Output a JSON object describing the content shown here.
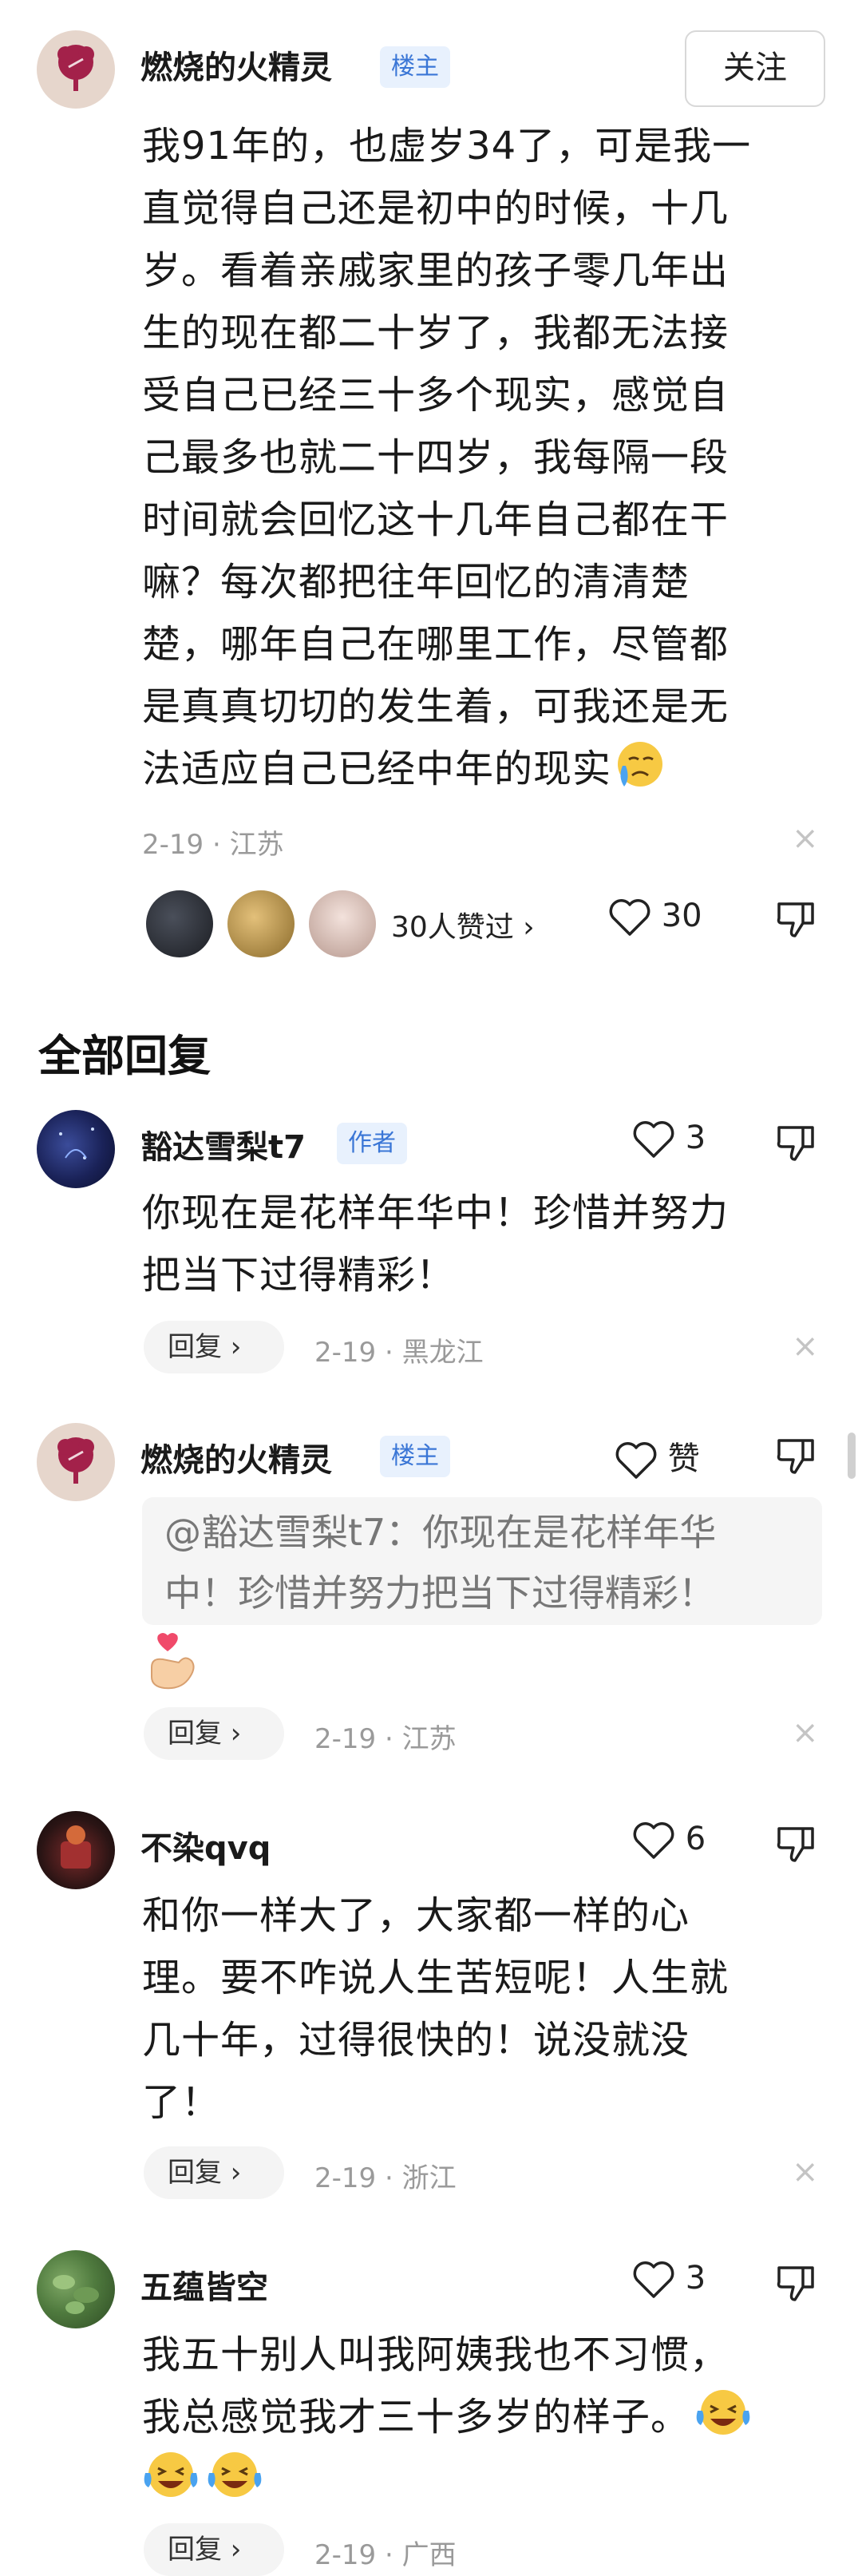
{
  "main_comment": {
    "author": "燃烧的火精灵",
    "badge": "楼主",
    "follow_label": "关注",
    "lines": [
      "我91年的，也虚岁34了，可是我一",
      "直觉得自己还是初中的时候，十几",
      "岁。看着亲戚家里的孩子零几年出",
      "生的现在都二十岁了，我都无法接",
      "受自己已经三十多个现实，感觉自",
      "己最多也就二十四岁，我每隔一段",
      "时间就会回忆这十几年自己都在干",
      "嘛？每次都把往年回忆的清清楚",
      "楚，哪年自己在哪里工作，尽管都",
      "是真真切切的发生着，可我还是无",
      "法适应自己已经中年的现实"
    ],
    "meta": "2-19 · 江苏",
    "likers_text": "30人赞过 ›",
    "like_count": "30",
    "close": "×"
  },
  "section_title": "全部回复",
  "replies": [
    {
      "author": "豁达雪梨t7",
      "badge": "作者",
      "like": "3",
      "lines": [
        "你现在是花样年华中！珍惜并努力",
        "把当下过得精彩！"
      ],
      "reply_label": "回复 ›",
      "meta": "2-19 · 黑龙江",
      "close": "×"
    },
    {
      "author": "燃烧的火精灵",
      "badge": "楼主",
      "like": "赞",
      "quote_lines": [
        "@豁达雪梨t7：你现在是花样年华",
        "中！珍惜并努力把当下过得精彩！"
      ],
      "reply_label": "回复 ›",
      "meta": "2-19 · 江苏",
      "close": "×"
    },
    {
      "author": "不染qvq",
      "like": "6",
      "lines": [
        "和你一样大了，大家都一样的心",
        "理。要不咋说人生苦短呢！人生就",
        "几十年，过得很快的！说没就没",
        "了！"
      ],
      "reply_label": "回复 ›",
      "meta": "2-19 · 浙江",
      "close": "×"
    },
    {
      "author": "五蕴皆空",
      "like": "3",
      "lines": [
        "我五十别人叫我阿姨我也不习惯，",
        "我总感觉我才三十多岁的样子。"
      ],
      "reply_label": "回复 ›",
      "meta": "2-19 · 广西"
    }
  ],
  "icons": {
    "heart": "heart-icon",
    "dislike": "thumbs-down-icon",
    "close": "close-icon",
    "flower": "flower-icon",
    "crying": "crying-emoji",
    "laughing": "laughing-tears-emoji",
    "finger_heart": "finger-heart-emoji"
  },
  "colors": {
    "badge_bg": "#e8f1fd",
    "badge_text": "#3a76d6",
    "meta": "#9a9a9a",
    "avatar_flower": "#a3214a"
  }
}
